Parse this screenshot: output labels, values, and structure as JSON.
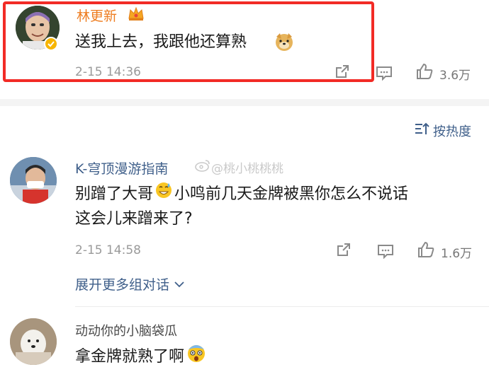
{
  "comments": [
    {
      "username": "林更新",
      "text": "送我上去，我跟他还算熟",
      "time": "2-15 14:36",
      "likes": "3.6万"
    },
    {
      "username": "K-穹顶漫游指南",
      "text_line1": "别蹭了大哥",
      "text_line1b": "小鸣前几天金牌被黑你怎么不说话",
      "text_line2": "这会儿来蹭来了?",
      "time": "2-15 14:58",
      "likes": "1.6万",
      "expand": "展开更多组对话"
    },
    {
      "username": "动动你的小脑袋瓜",
      "text": "拿金牌就熟了啊"
    }
  ],
  "sort": {
    "label": "按热度"
  },
  "watermark": "@桃小桃桃桃",
  "colors": {
    "highlight": "#f22b26",
    "vip_name": "#ee7d20",
    "link_blue": "#3f5f8a",
    "meta_gray": "#9a9a9a"
  },
  "icons": [
    "crown-icon",
    "verified-badge-icon",
    "doge-emoji",
    "share-icon",
    "comment-icon",
    "like-icon",
    "sort-icon",
    "grin-sweat-emoji",
    "chevron-down-icon",
    "weibo-logo-icon",
    "scared-emoji"
  ]
}
